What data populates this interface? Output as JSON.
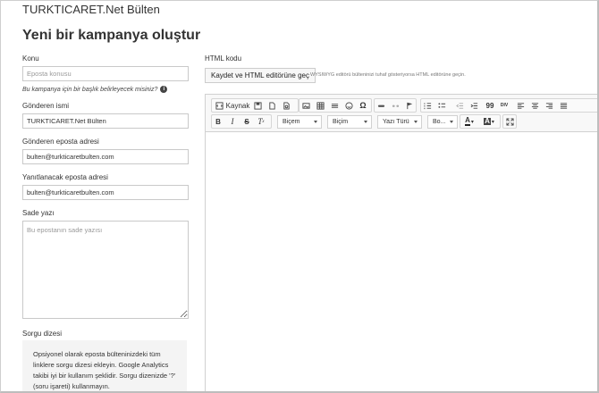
{
  "app": {
    "title": "TURKTICARET.Net Bülten"
  },
  "page": {
    "title": "Yeni bir kampanya oluştur"
  },
  "form": {
    "subject": {
      "label": "Konu",
      "placeholder": "Eposta konusu",
      "hint": "Bu kampanya için bir başlık belirleyecek misiniz?"
    },
    "sender_name": {
      "label": "Gönderen ismi",
      "value": "TURKTICARET.Net Bülten"
    },
    "sender_email": {
      "label": "Gönderen eposta adresi",
      "value": "bulten@turkticaretbulten.com"
    },
    "reply_email": {
      "label": "Yanıtlanacak eposta adresi",
      "value": "bulten@turkticaretbulten.com"
    },
    "plain_text": {
      "label": "Sade yazı",
      "placeholder": "Bu epostanın sade yazısı"
    },
    "query_string": {
      "label": "Sorgu dizesi",
      "notice": "Opsiyonel olarak eposta bülteninizdeki tüm linklere sorgu dizesi ekleyin. Google Analytics takibi iyi bir kullanım şeklidir. Sorgu dizenizde '?' (soru işareti) kullanmayın."
    }
  },
  "html_code": {
    "label": "HTML kodu",
    "toggle_button": "Kaydet ve HTML editörüne geç",
    "toggle_hint": "WYSIWYG editörü bülteninizi tuhaf gösteriyorsa HTML editörüne geçin."
  },
  "editor": {
    "source_label": "Kaynak",
    "combo_styles": "Biçem",
    "combo_format": "Biçim",
    "combo_font": "Yazı Türü",
    "combo_size": "Bo...",
    "icons": {
      "source": "source-icon",
      "save": "save-icon",
      "new_page": "new-page-icon",
      "preview": "preview-icon",
      "image": "image-icon",
      "table": "table-icon",
      "hr": "horizontal-line-icon",
      "smiley": "smiley-icon",
      "special_char": "special-char-icon",
      "link": "link-icon",
      "unlink": "unlink-icon",
      "anchor": "anchor-icon",
      "numbered_list": "numbered-list-icon",
      "bullet_list": "bullet-list-icon",
      "outdent": "outdent-icon",
      "indent": "indent-icon",
      "blockquote": "blockquote-icon",
      "div": "div-icon",
      "align_left": "align-left-icon",
      "align_center": "align-center-icon",
      "align_right": "align-right-icon",
      "justify": "justify-icon",
      "bold": "bold-icon",
      "italic": "italic-icon",
      "strike": "strikethrough-icon",
      "remove_format": "remove-format-icon",
      "text_color": "text-color-icon",
      "bg_color": "background-color-icon",
      "maximize": "maximize-icon"
    },
    "glyphs": {
      "bold": "B",
      "italic": "I",
      "strike": "S",
      "remove_format": "T",
      "text_color": "A",
      "bg_color": "A",
      "blockquote": "99",
      "div": "DIV",
      "special_char": "Ω"
    }
  }
}
